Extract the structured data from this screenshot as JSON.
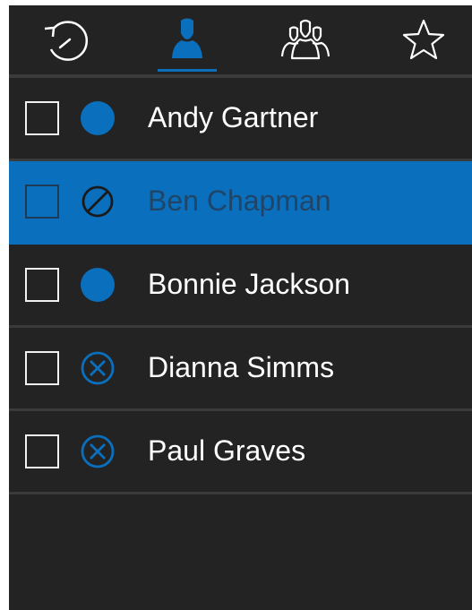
{
  "colors": {
    "accent": "#0a6fbd",
    "background": "#232323",
    "separator": "#3a3a3a",
    "text": "#ffffff",
    "selected_text": "#1f4568"
  },
  "tabs": [
    {
      "icon": "history-icon",
      "active": false
    },
    {
      "icon": "person-icon",
      "active": true
    },
    {
      "icon": "group-icon",
      "active": false
    },
    {
      "icon": "star-icon",
      "active": false
    }
  ],
  "contacts": [
    {
      "name": "Andy Gartner",
      "status": "available",
      "selected": false
    },
    {
      "name": "Ben Chapman",
      "status": "do-not-disturb",
      "selected": true
    },
    {
      "name": "Bonnie Jackson",
      "status": "available",
      "selected": false
    },
    {
      "name": "Dianna Simms",
      "status": "offline",
      "selected": false
    },
    {
      "name": "Paul Graves",
      "status": "offline",
      "selected": false
    }
  ]
}
